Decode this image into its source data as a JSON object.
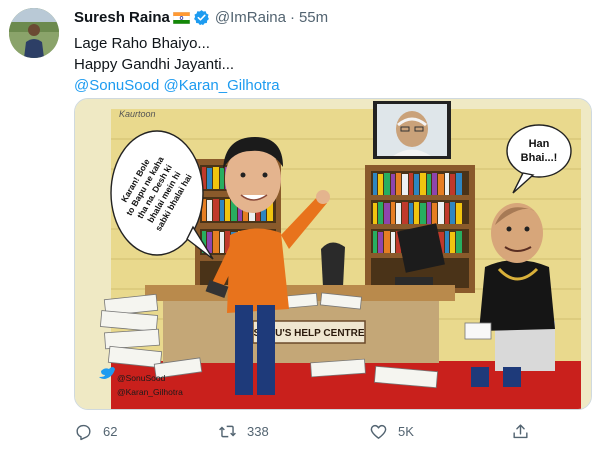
{
  "author": {
    "name": "Suresh Raina",
    "handle": "@ImRaina",
    "separator": "·",
    "time": "55m"
  },
  "tweet": {
    "lines": [
      "Lage Raho Bhaiyo...",
      "Happy Gandhi Jayanti..."
    ],
    "mentions": [
      "@SonuSood",
      "@Karan_Gilhotra"
    ]
  },
  "media": {
    "credit": "Kaurtoon",
    "left_bubble": [
      "Karan! Bole",
      "to Bapu ne kaha",
      "tha na. Desh ki",
      "bhalai mein hi",
      "sabki bhalai hai"
    ],
    "right_bubble": [
      "Han",
      "Bhai...!"
    ],
    "desk_sign": "SONU'S HELP CENTRE",
    "social": [
      "@SonuSood",
      "@Karan_Gilhotra"
    ]
  },
  "actions": {
    "replies": "62",
    "retweets": "338",
    "likes": "5K"
  },
  "colors": {
    "text": "#0f1419",
    "secondary": "#536471",
    "link": "#1d9bf0",
    "verified": "#1d9bf0",
    "wall": "#e8d98f",
    "orange_shirt": "#e8731c"
  },
  "icons": [
    "reply-icon",
    "retweet-icon",
    "like-icon",
    "share-icon",
    "verified-badge-icon",
    "india-flag-icon"
  ]
}
